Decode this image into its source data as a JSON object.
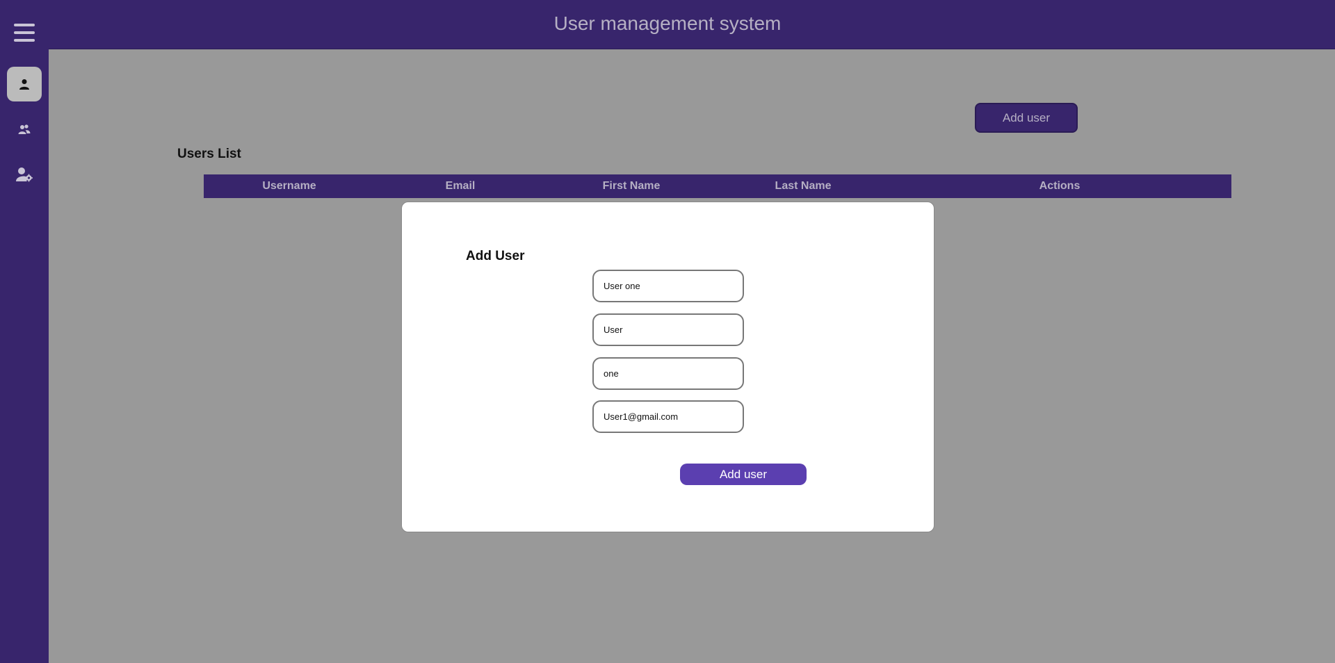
{
  "header": {
    "title": "User management system"
  },
  "sidebar": {
    "menu_icon": "hamburger-menu-icon",
    "items": [
      {
        "icon": "user-icon",
        "active": true
      },
      {
        "icon": "users-group-icon",
        "active": false
      },
      {
        "icon": "user-settings-icon",
        "active": false
      }
    ]
  },
  "main": {
    "add_user_button": "Add user",
    "users_list_title": "Users List",
    "table": {
      "columns": [
        "Username",
        "Email",
        "First Name",
        "Last Name",
        "Actions"
      ],
      "rows": []
    }
  },
  "modal": {
    "title": "Add User",
    "fields": {
      "username": "User one",
      "first_name": "User",
      "last_name": "one",
      "email": "User1@gmail.com"
    },
    "submit_label": "Add user"
  },
  "colors": {
    "primary": "#38256c",
    "accent": "#5b3fb0",
    "overlay": "#999999",
    "header_text": "#b6b0c4"
  }
}
